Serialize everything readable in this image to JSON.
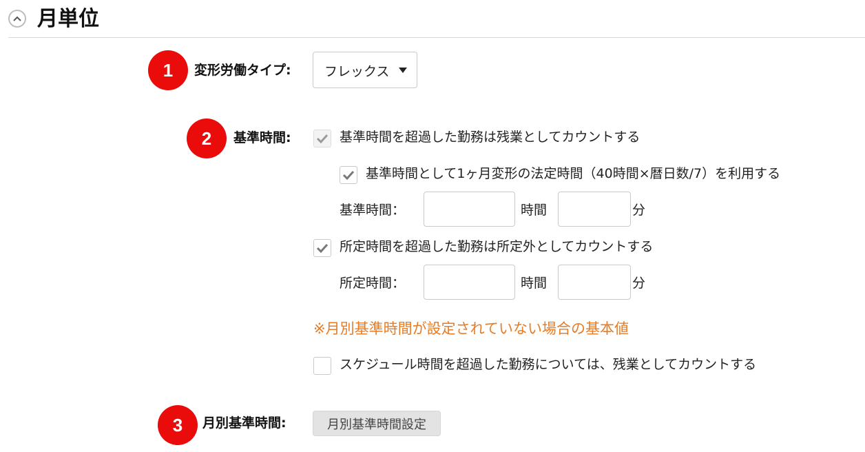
{
  "section": {
    "title": "月単位",
    "collapse_icon": "chevron-up-icon"
  },
  "badges": [
    "1",
    "2",
    "3"
  ],
  "work_type": {
    "label": "変形労働タイプ:",
    "selected": "フレックス"
  },
  "base_time": {
    "label": "基準時間:",
    "overtime_checkbox": {
      "label": "基準時間を超過した勤務は残業としてカウントする",
      "checked": true,
      "disabled": true
    },
    "legal_checkbox": {
      "label": "基準時間として1ヶ月変形の法定時間（40時間×暦日数/7）を利用する",
      "checked": true
    },
    "base_hours": {
      "label": "基準時間：",
      "hours_value": "",
      "hours_unit": "時間",
      "minutes_value": "",
      "minutes_unit": "分"
    },
    "scheduled_checkbox": {
      "label": "所定時間を超過した勤務は所定外としてカウントする",
      "checked": true
    },
    "scheduled_hours": {
      "label": "所定時間：",
      "hours_value": "",
      "hours_unit": "時間",
      "minutes_value": "",
      "minutes_unit": "分"
    },
    "note": "※月別基準時間が設定されていない場合の基本値",
    "schedule_checkbox": {
      "label": "スケジュール時間を超過した勤務については、残業としてカウントする",
      "checked": false
    }
  },
  "monthly": {
    "label": "月別基準時間:",
    "button_label": "月別基準時間設定"
  },
  "colors": {
    "badge": "#ea0b0b",
    "note": "#e87b23",
    "check": "#777777"
  }
}
